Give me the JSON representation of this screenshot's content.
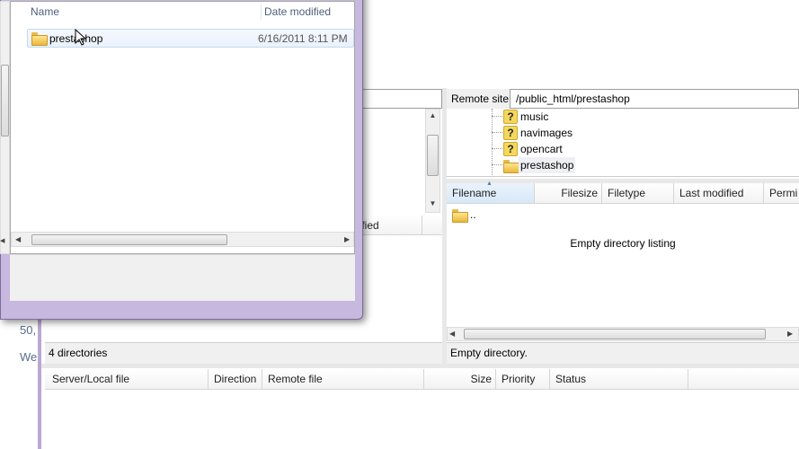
{
  "background": {
    "left_fragment_text_1": "50,",
    "left_fragment_text_2": "We",
    "local": {
      "list_header_fragment": "dified",
      "status": "4 directories"
    },
    "remote": {
      "site_label": "Remote site:",
      "site_path": "/public_html/prestashop",
      "tree_items": [
        {
          "label": "music",
          "icon": "question-folder-icon"
        },
        {
          "label": "navimages",
          "icon": "question-folder-icon"
        },
        {
          "label": "opencart",
          "icon": "question-folder-icon"
        },
        {
          "label": "prestashop",
          "icon": "folder-icon"
        }
      ],
      "columns": [
        "Filename",
        "Filesize",
        "Filetype",
        "Last modified",
        "Permi"
      ],
      "parent_entry": "..",
      "empty_message": "Empty directory listing",
      "status": "Empty directory."
    },
    "queue": {
      "columns": [
        "Server/Local file",
        "Direction",
        "Remote file",
        "Size",
        "Priority",
        "Status"
      ]
    }
  },
  "dialog": {
    "columns": {
      "name": "Name",
      "date": "Date modified"
    },
    "rows": [
      {
        "name": "prestashop",
        "date": "6/16/2011 8:11 PM"
      }
    ]
  },
  "colors": {
    "dialog_frame": "#c6b8de",
    "header_text": "#4c607a",
    "selection": "#e9f1fb"
  }
}
